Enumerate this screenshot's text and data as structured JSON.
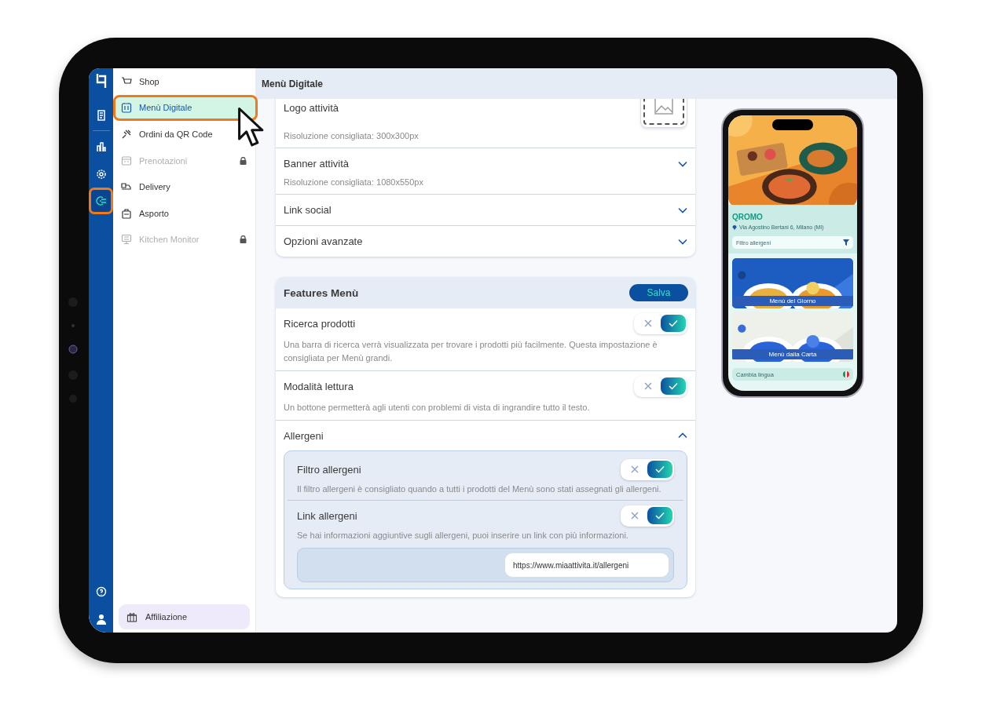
{
  "rail": {
    "top_items": [
      {
        "kind": "receipt",
        "selected": false
      },
      {
        "kind": "chart",
        "selected": false
      },
      {
        "kind": "gear",
        "selected": false
      },
      {
        "kind": "plug",
        "selected": true
      }
    ],
    "bottom_items": [
      {
        "kind": "help",
        "selected": false
      },
      {
        "kind": "user",
        "selected": false
      }
    ]
  },
  "sidebar": {
    "items": [
      {
        "label": "Shop",
        "kind": "cart",
        "selected": false,
        "locked": false
      },
      {
        "label": "Menù Digitale",
        "kind": "menu",
        "selected": true,
        "locked": false
      },
      {
        "label": "Ordini da QR Code",
        "kind": "qr",
        "selected": false,
        "locked": false
      },
      {
        "label": "Prenotazioni",
        "kind": "calendar",
        "selected": false,
        "locked": true
      },
      {
        "label": "Delivery",
        "kind": "scooter",
        "selected": false,
        "locked": false
      },
      {
        "label": "Asporto",
        "kind": "bag",
        "selected": false,
        "locked": false
      },
      {
        "label": "Kitchen Monitor",
        "kind": "monitor",
        "selected": false,
        "locked": true
      }
    ],
    "footer": {
      "label": "Affiliazione"
    }
  },
  "header": {
    "title": "Menù Digitale"
  },
  "info_card": {
    "rows": [
      {
        "kind": "upload",
        "label": "Logo attività",
        "hint": "Risoluzione consigliata: 300x300px"
      },
      {
        "kind": "collapsible",
        "label": "Banner attività",
        "hint": "Risoluzione consigliata: 1080x550px",
        "expanded": false
      },
      {
        "kind": "collapsible",
        "label": "Link social",
        "expanded": false
      },
      {
        "kind": "collapsible",
        "label": "Opzioni avanzate",
        "expanded": false
      }
    ]
  },
  "features": {
    "title": "Features Menù",
    "save_button": "Salva",
    "rows": [
      {
        "label": "Ricerca prodotti",
        "description": "Una barra di ricerca verrà visualizzata per trovare i prodotti più facilmente. Questa impostazione è consigliata per Menù grandi.",
        "on": true
      },
      {
        "label": "Modalità lettura",
        "description": "Un bottone permetterà agli utenti con problemi di vista di ingrandire tutto il testo.",
        "on": true
      }
    ],
    "allergens": {
      "label": "Allergeni",
      "expanded": true,
      "rows": [
        {
          "label": "Filtro allergeni",
          "description": "Il filtro allergeni è consigliato quando a tutti i prodotti del Menù sono stati assegnati gli allergeni.",
          "on": true
        },
        {
          "label": "Link allergeni",
          "description": "Se hai informazioni aggiuntive sugli allergeni, puoi inserire un link con più informazioni.",
          "on": true,
          "url": "https://www.miaattivita.it/allergeni"
        }
      ]
    }
  },
  "preview": {
    "name": "QROMO",
    "address": "Via Agostino Bertani 6, Milano (MI)",
    "filter": {
      "placeholder": "Filtro allergeni"
    },
    "menus": [
      {
        "label": "Menù del Giorno",
        "kind": "picture"
      },
      {
        "label": "Menù dalla Carta",
        "kind": "picture"
      }
    ],
    "language": {
      "label": "Cambia lingua"
    }
  }
}
